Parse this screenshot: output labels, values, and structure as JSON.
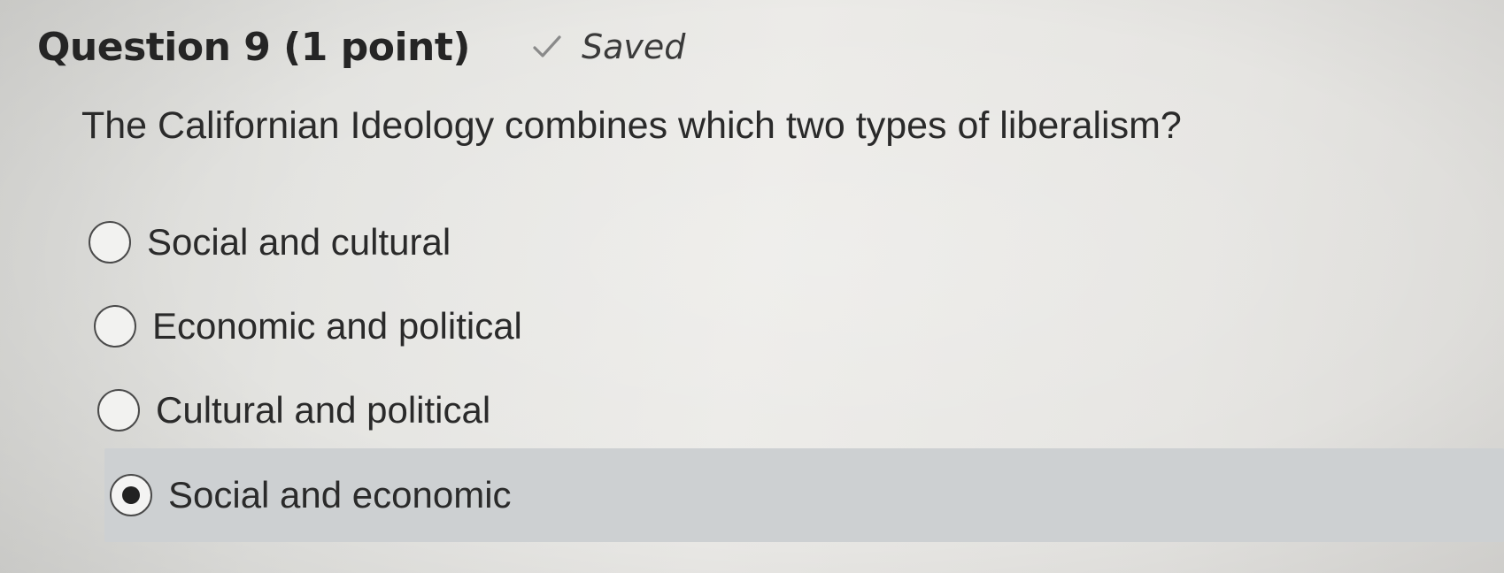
{
  "question": {
    "title": "Question 9 (1 point)",
    "status": "Saved",
    "status_icon": "checkmark-icon",
    "prompt": "The Californian Ideology combines which two types of liberalism?"
  },
  "options": [
    {
      "label": "Social and cultural",
      "selected": false
    },
    {
      "label": "Economic and political",
      "selected": false
    },
    {
      "label": "Cultural and political",
      "selected": false
    },
    {
      "label": "Social and economic",
      "selected": true
    }
  ],
  "colors": {
    "selected_row_bg": "#cdd0d2",
    "text": "#2a2a2a"
  }
}
